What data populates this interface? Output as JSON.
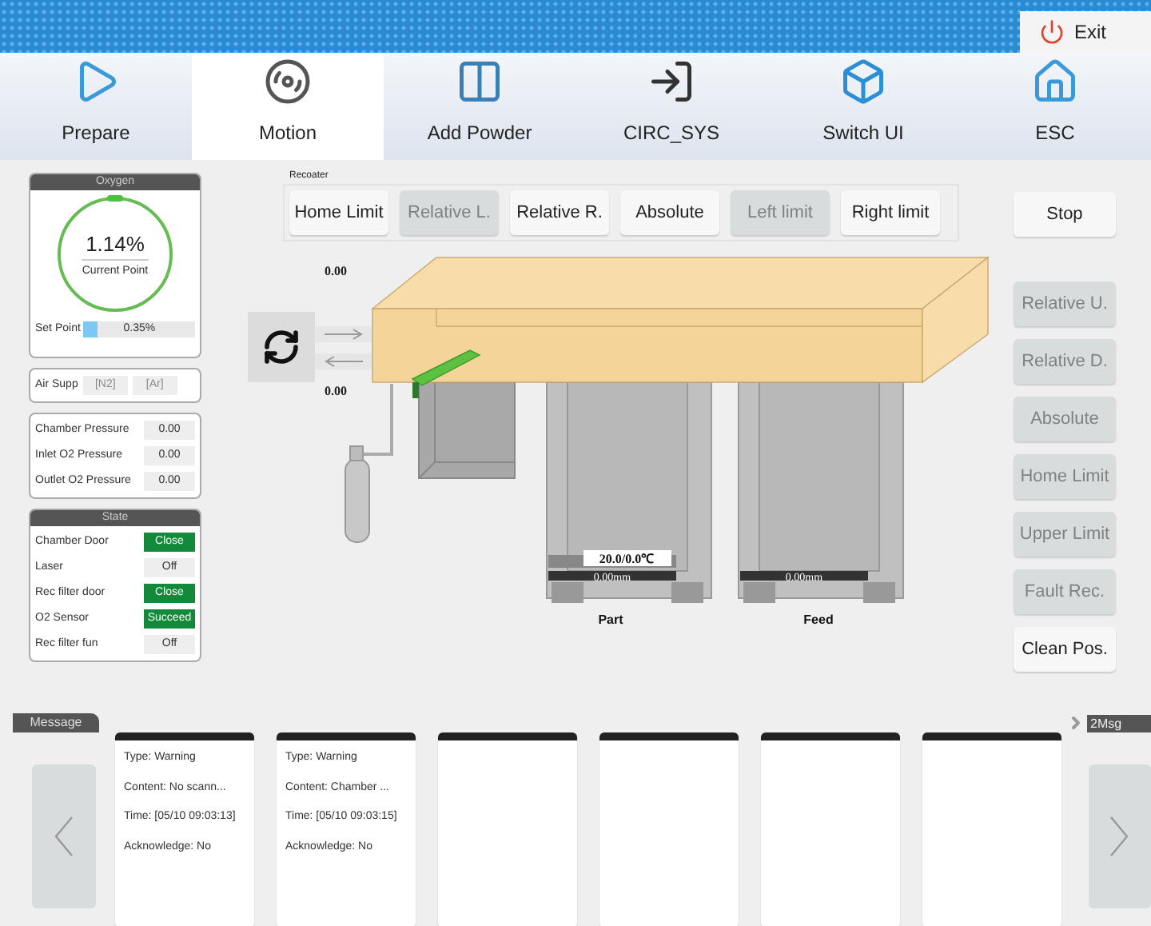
{
  "top_bar": {
    "exit_button": "Exit"
  },
  "nav_tabs": [
    {
      "label": "Prepare",
      "kind": "prepare",
      "selected": false
    },
    {
      "label": "Motion",
      "kind": "motion",
      "selected": true
    },
    {
      "label": "Add Powder",
      "kind": "powder",
      "selected": false
    },
    {
      "label": "CIRC_SYS",
      "kind": "circ",
      "selected": false
    },
    {
      "label": "Switch UI",
      "kind": "switch",
      "selected": false
    },
    {
      "label": "ESC",
      "kind": "home",
      "selected": false
    }
  ],
  "oxygen": {
    "title": "Oxygen",
    "value": "1.14%",
    "value_label": "Current Point",
    "set_point_label": "Set Point",
    "set_point_value": "0.35%",
    "level": 0.12
  },
  "air_supply": {
    "label": "Air Supp",
    "options": [
      {
        "label": "[N2]",
        "disabled": true
      },
      {
        "label": "[Ar]",
        "disabled": true
      }
    ]
  },
  "pressures": [
    {
      "label": "Chamber Pressure",
      "value": "0.00"
    },
    {
      "label": "Inlet O2 Pressure",
      "value": "0.00"
    },
    {
      "label": "Outlet O2 Pressure",
      "value": "0.00"
    }
  ],
  "state": {
    "title": "State",
    "items": [
      {
        "label": "Chamber Door",
        "value": "Close",
        "on": true
      },
      {
        "label": "Laser",
        "value": "Off",
        "on": false
      },
      {
        "label": "Rec filter door",
        "value": "Close",
        "on": true
      },
      {
        "label": "O2 Sensor",
        "value": "Succeed",
        "on": true
      },
      {
        "label": "Rec filter fun",
        "value": "Off",
        "on": false
      }
    ]
  },
  "recoater": {
    "title": "Recoater",
    "buttons": [
      {
        "label": "Home Limit",
        "disabled": false
      },
      {
        "label": "Relative L.",
        "disabled": true
      },
      {
        "label": "Relative R.",
        "disabled": false
      },
      {
        "label": "Absolute",
        "disabled": false
      },
      {
        "label": "Left limit",
        "disabled": true
      },
      {
        "label": "Right limit",
        "disabled": false
      }
    ]
  },
  "diagram": {
    "recoater_top_reading": "0.00",
    "recoater_bottom_reading": "0.00",
    "part_temperature": "20.0/0.0℃",
    "part_height": "0.00mm",
    "feed_height": "0.00mm",
    "part_label": "Part",
    "feed_label": "Feed"
  },
  "side_buttons": [
    {
      "label": "Stop",
      "disabled": false
    },
    {
      "label": "Relative U.",
      "disabled": true
    },
    {
      "label": "Relative D.",
      "disabled": true
    },
    {
      "label": "Absolute",
      "disabled": true
    },
    {
      "label": "Home Limit",
      "disabled": true
    },
    {
      "label": "Upper Limit",
      "disabled": true
    },
    {
      "label": "Fault Rec.",
      "disabled": true
    },
    {
      "label": "Clean Pos.",
      "disabled": false
    }
  ],
  "messages": {
    "title": "Message",
    "count": "2Msg",
    "cards": [
      {
        "kind": "message",
        "type": "Type: Warning",
        "content": "Content: No scann...",
        "time": "Time: [05/10 09:03:13]",
        "acknowledge": "Acknowledge: No"
      },
      {
        "kind": "message",
        "type": "Type: Warning",
        "content": "Content: Chamber ...",
        "time": "Time: [05/10 09:03:15]",
        "acknowledge": "Acknowledge: No"
      },
      {
        "kind": "empty"
      },
      {
        "kind": "empty"
      },
      {
        "kind": "empty"
      },
      {
        "kind": "empty"
      }
    ]
  }
}
